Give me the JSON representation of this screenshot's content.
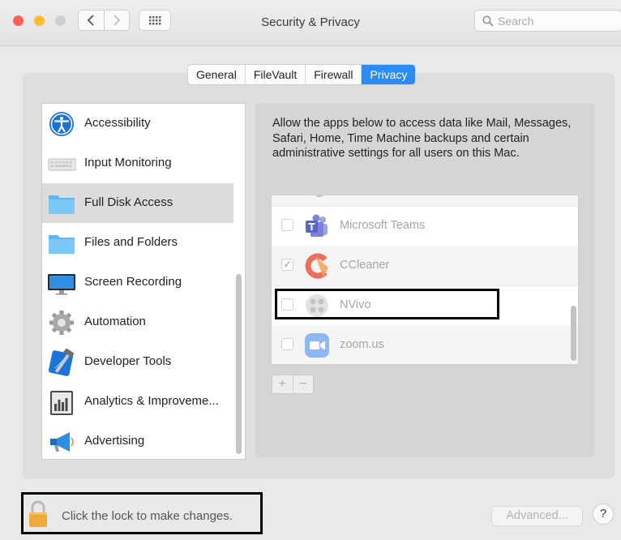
{
  "window": {
    "title": "Security & Privacy",
    "search_placeholder": "Search"
  },
  "tabs": [
    {
      "label": "General",
      "active": false
    },
    {
      "label": "FileVault",
      "active": false
    },
    {
      "label": "Firewall",
      "active": false
    },
    {
      "label": "Privacy",
      "active": true
    }
  ],
  "sidebar": {
    "items": [
      {
        "label": "Accessibility",
        "icon": "accessibility-icon"
      },
      {
        "label": "Input Monitoring",
        "icon": "keyboard-icon"
      },
      {
        "label": "Full Disk Access",
        "icon": "folder-icon",
        "selected": true
      },
      {
        "label": "Files and Folders",
        "icon": "folder-icon"
      },
      {
        "label": "Screen Recording",
        "icon": "display-icon"
      },
      {
        "label": "Automation",
        "icon": "gear-icon"
      },
      {
        "label": "Developer Tools",
        "icon": "hammer-icon"
      },
      {
        "label": "Analytics & Improveme...",
        "icon": "analytics-icon"
      },
      {
        "label": "Advertising",
        "icon": "megaphone-icon"
      }
    ]
  },
  "privacy": {
    "description": "Allow the apps below to access data like Mail, Messages, Safari, Home, Time Machine backups and certain administrative settings for all users on this Mac.",
    "apps": [
      {
        "label": "Microsoft Teams",
        "checked": false,
        "icon": "teams-icon"
      },
      {
        "label": "CCleaner",
        "checked": true,
        "icon": "ccleaner-icon"
      },
      {
        "label": "NVivo",
        "checked": false,
        "icon": "nvivo-icon"
      },
      {
        "label": "zoom.us",
        "checked": false,
        "icon": "zoom-icon"
      }
    ],
    "add_label": "+",
    "remove_label": "−"
  },
  "footer": {
    "lock_text": "Click the lock to make changes.",
    "advanced_label": "Advanced...",
    "help_label": "?"
  },
  "colors": {
    "accent": "#2b8cf6",
    "close": "#fe5f57",
    "minimize": "#febc2e",
    "zoom_disabled": "#cfcfcf"
  }
}
